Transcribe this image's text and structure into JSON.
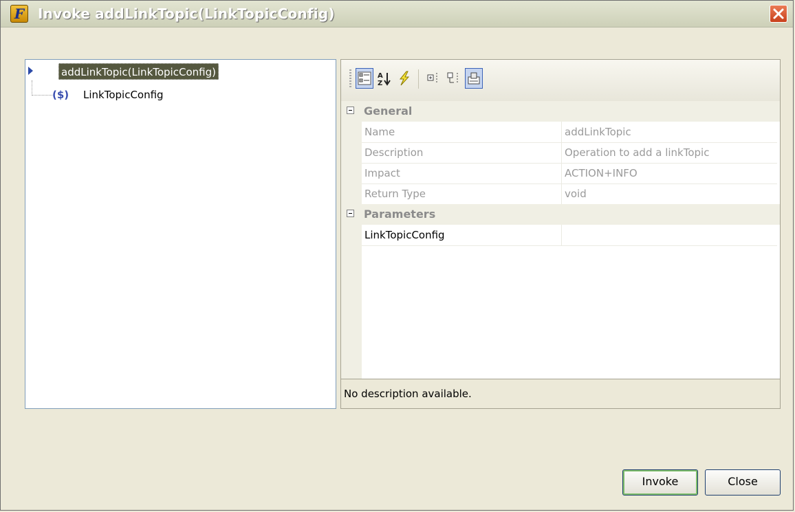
{
  "window": {
    "title": "Invoke addLinkTopic(LinkTopicConfig)",
    "app_icon_letter": "F",
    "close_icon": "close-x-icon"
  },
  "tree": {
    "root_label": "addLinkTopic(LinkTopicConfig)",
    "child_icon_text": "($)",
    "child_label": "LinkTopicConfig"
  },
  "toolbar": {
    "buttons": [
      {
        "icon": "categorized-icon",
        "pressed": true
      },
      {
        "icon": "alphabetical-sort-icon",
        "pressed": false
      },
      {
        "icon": "events-lightning-icon",
        "pressed": false
      },
      {
        "icon": "expand-all-icon",
        "pressed": false
      },
      {
        "icon": "collapse-all-icon",
        "pressed": false
      },
      {
        "icon": "property-pages-icon",
        "pressed": true
      }
    ]
  },
  "properties": {
    "general_label": "General",
    "general": [
      {
        "name": "Name",
        "value": "addLinkTopic"
      },
      {
        "name": "Description",
        "value": "Operation to add a linkTopic"
      },
      {
        "name": "Impact",
        "value": "ACTION+INFO"
      },
      {
        "name": "Return Type",
        "value": "void"
      }
    ],
    "parameters_label": "Parameters",
    "parameters": [
      {
        "name": "LinkTopicConfig",
        "value": ""
      }
    ]
  },
  "description_text": "No description available.",
  "buttons": {
    "invoke_label": "Invoke",
    "close_label": "Close"
  },
  "colors": {
    "selection_bg": "#55583f",
    "panel_bg": "#ece9d8",
    "default_button_ring": "#7fbf6b"
  }
}
